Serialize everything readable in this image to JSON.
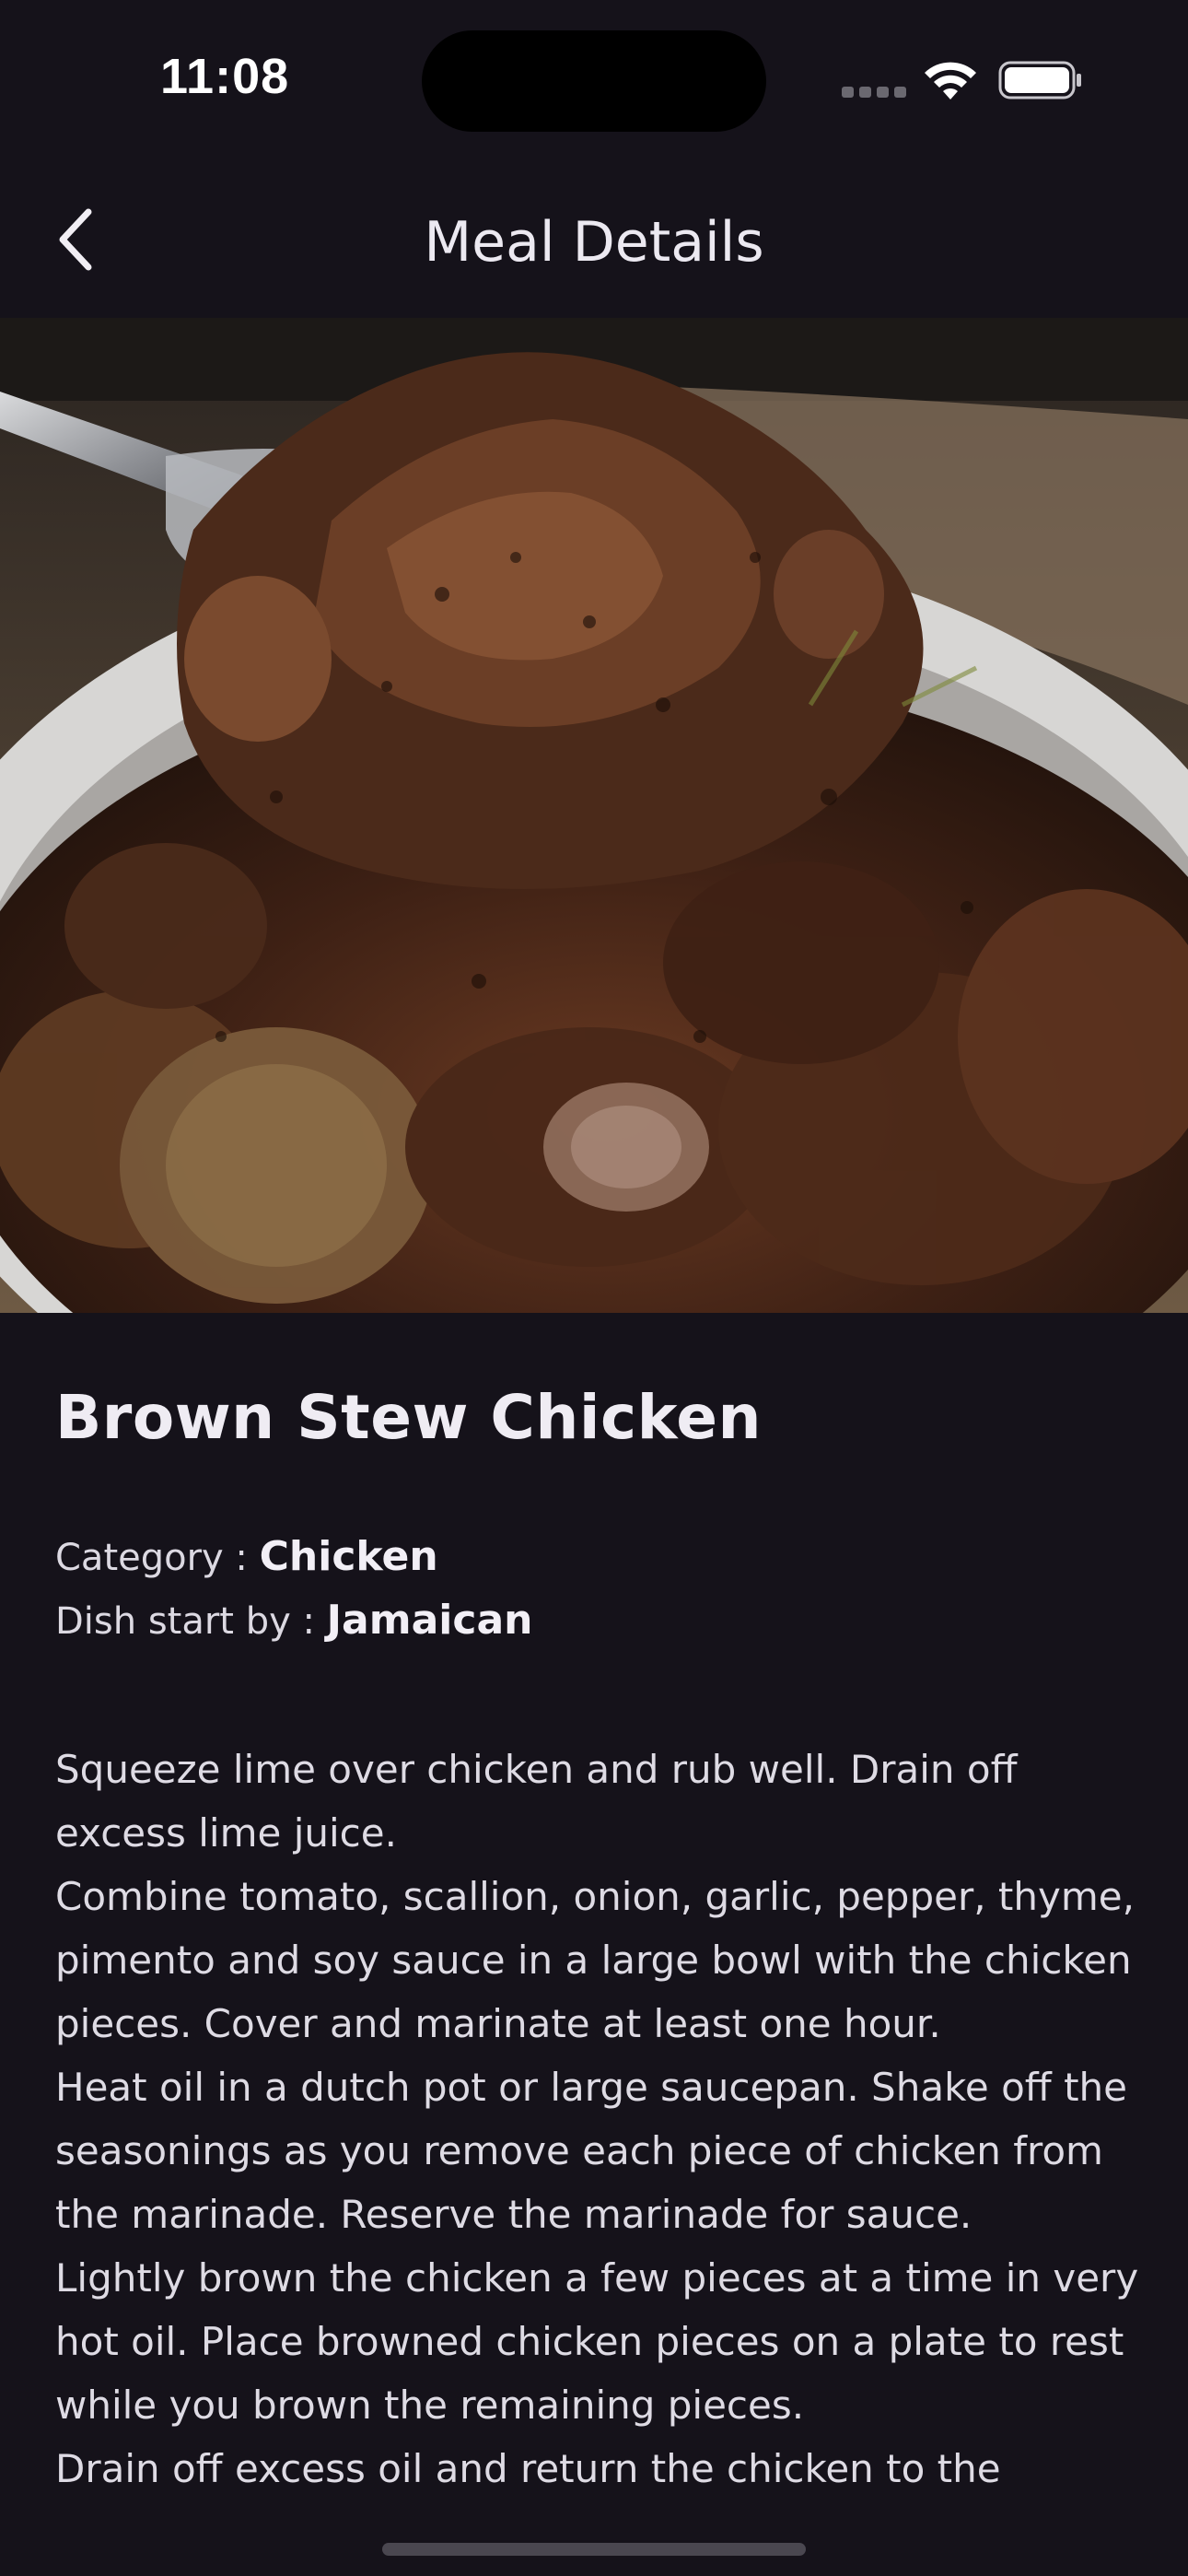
{
  "status_bar": {
    "time": "11:08"
  },
  "nav": {
    "title": "Meal Details",
    "back_icon": "chevron-left-icon"
  },
  "meal": {
    "name": "Brown Stew Chicken",
    "category_label": "Category : ",
    "category": "Chicken",
    "area_label": "Dish start by : ",
    "area": "Jamaican",
    "instructions": "Squeeze lime over chicken and rub well. Drain off excess lime juice.\nCombine tomato, scallion, onion, garlic, pepper, thyme, pimento and soy sauce in a large bowl with the chicken pieces. Cover and marinate at least one hour.\nHeat oil in a dutch pot or large saucepan. Shake off the seasonings as you remove each piece of chicken from the marinade. Reserve the marinade for sauce.\nLightly brown the chicken a few pieces at a time in very hot oil. Place browned chicken pieces on a plate to rest while you brown the remaining pieces.\nDrain off excess oil and return the chicken to the"
  },
  "colors": {
    "background": "#15121a",
    "text": "#e9e6ee"
  }
}
